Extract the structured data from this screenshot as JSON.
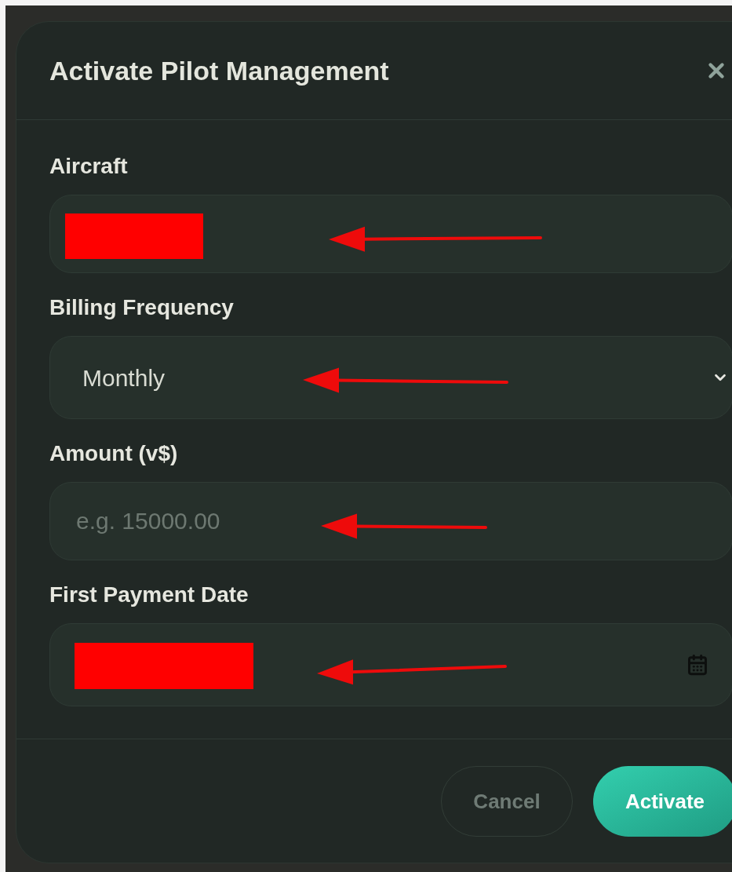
{
  "dialog": {
    "title": "Activate Pilot Management",
    "fields": [
      {
        "label": "Aircraft",
        "kind": "text",
        "redacted": true
      },
      {
        "label": "Billing Frequency",
        "kind": "select",
        "value": "Monthly"
      },
      {
        "label": "Amount (v$)",
        "kind": "number",
        "placeholder": "e.g. 15000.00"
      },
      {
        "label": "First Payment Date",
        "kind": "date",
        "redacted": true
      }
    ],
    "buttons": [
      {
        "label": "Cancel",
        "kind": "secondary"
      },
      {
        "label": "Activate",
        "kind": "primary"
      }
    ]
  }
}
